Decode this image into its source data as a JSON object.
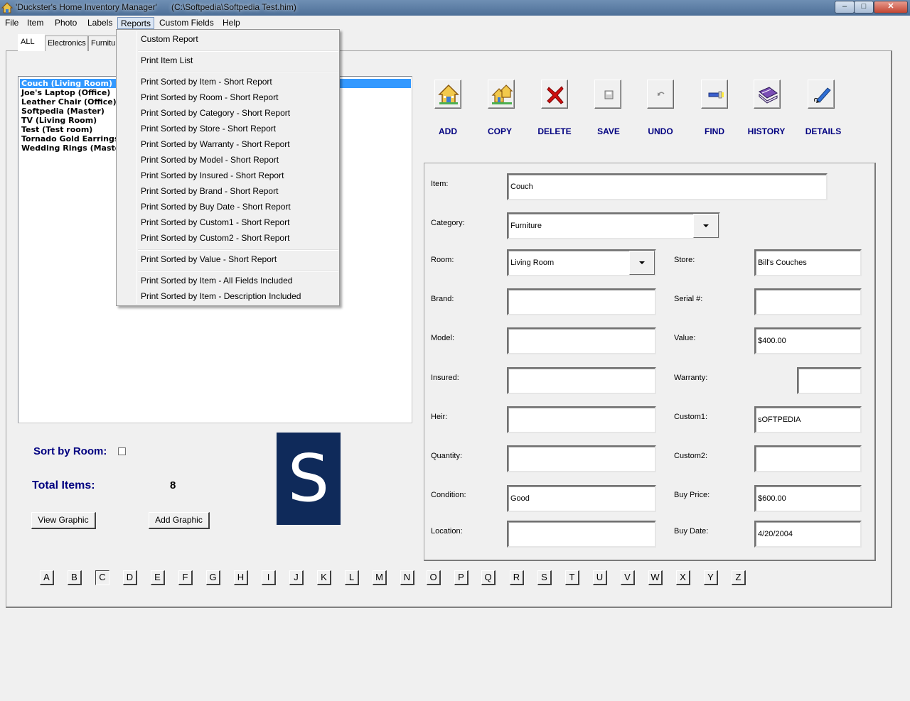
{
  "window": {
    "title": "'Duckster's Home Inventory Manager'      (C:\\Softpedia\\Softpedia Test.him)",
    "min": "–",
    "max": "□",
    "close": "✕"
  },
  "menubar": [
    "File",
    "Item",
    "Photo",
    "Labels",
    "Reports",
    "Custom Fields",
    "Help"
  ],
  "tabs": [
    "ALL",
    "Electronics",
    "Furnitur"
  ],
  "items": [
    "Couch (Living Room)",
    "Joe's Laptop (Office)",
    "Leather Chair (Office)",
    "Softpedia (Master)",
    "TV (Living Room)",
    "Test (Test room)",
    "Tornado Gold Earrings (",
    "Wedding Rings (Master"
  ],
  "reports_menu": [
    "Custom Report",
    "Print Item List",
    "Print Sorted by Item - Short Report",
    "Print Sorted by Room - Short Report",
    "Print Sorted by Category - Short Report",
    "Print Sorted by Store - Short Report",
    "Print Sorted by Warranty - Short Report",
    "Print Sorted by Model - Short Report",
    "Print Sorted by Insured - Short Report",
    "Print Sorted by Brand - Short Report",
    "Print Sorted by Buy Date - Short Report",
    "Print Sorted by Custom1 - Short Report",
    "Print Sorted by Custom2 - Short Report",
    "Print Sorted by Value - Short Report",
    "Print Sorted by Item - All Fields Included",
    "Print Sorted by Item - Description Included"
  ],
  "toolbar": [
    "ADD",
    "COPY",
    "DELETE",
    "SAVE",
    "UNDO",
    "FIND",
    "HISTORY",
    "DETAILS"
  ],
  "toolbar_icons": [
    "house-add-icon",
    "houses-copy-icon",
    "red-x-icon",
    "floppy-save-icon",
    "undo-arrow-icon",
    "flashlight-find-icon",
    "books-history-icon",
    "pen-details-icon"
  ],
  "form": {
    "item_label": "Item:",
    "item": "Couch",
    "category_label": "Category:",
    "category": "Furniture",
    "room_label": "Room:",
    "room": "Living Room",
    "store_label": "Store:",
    "store": "Bill's Couches",
    "brand_label": "Brand:",
    "brand": "",
    "serial_label": "Serial #:",
    "serial": "",
    "model_label": "Model:",
    "model": "",
    "value_label": "Value:",
    "value": "$400.00",
    "insured_label": "Insured:",
    "insured": "",
    "warranty_label": "Warranty:",
    "warranty": "",
    "heir_label": "Heir:",
    "heir": "",
    "custom1_label": "Custom1:",
    "custom1": "sOFTPEDIA",
    "quantity_label": "Quantity:",
    "quantity": "",
    "custom2_label": "Custom2:",
    "custom2": "",
    "condition_label": "Condition:",
    "condition": "Good",
    "buy_price_label": "Buy Price:",
    "buy_price": "$600.00",
    "location_label": "Location:",
    "location": "",
    "buy_date_label": "Buy Date:",
    "buy_date": "4/20/2004"
  },
  "bottom": {
    "sort_by_room": "Sort by Room:",
    "total_items_label": "Total Items:",
    "total_items": "8",
    "view_graphic": "View Graphic",
    "add_graphic": "Add Graphic",
    "logo_letter": "S"
  },
  "letters": [
    "A",
    "B",
    "C",
    "D",
    "E",
    "F",
    "G",
    "H",
    "I",
    "J",
    "K",
    "L",
    "M",
    "N",
    "O",
    "P",
    "Q",
    "R",
    "S",
    "T",
    "U",
    "V",
    "W",
    "X",
    "Y",
    "Z"
  ],
  "pressed_letter": "C",
  "colors": {
    "accent": "#000080",
    "selection": "#3399ff",
    "logo_bg": "#0f2a5a"
  }
}
